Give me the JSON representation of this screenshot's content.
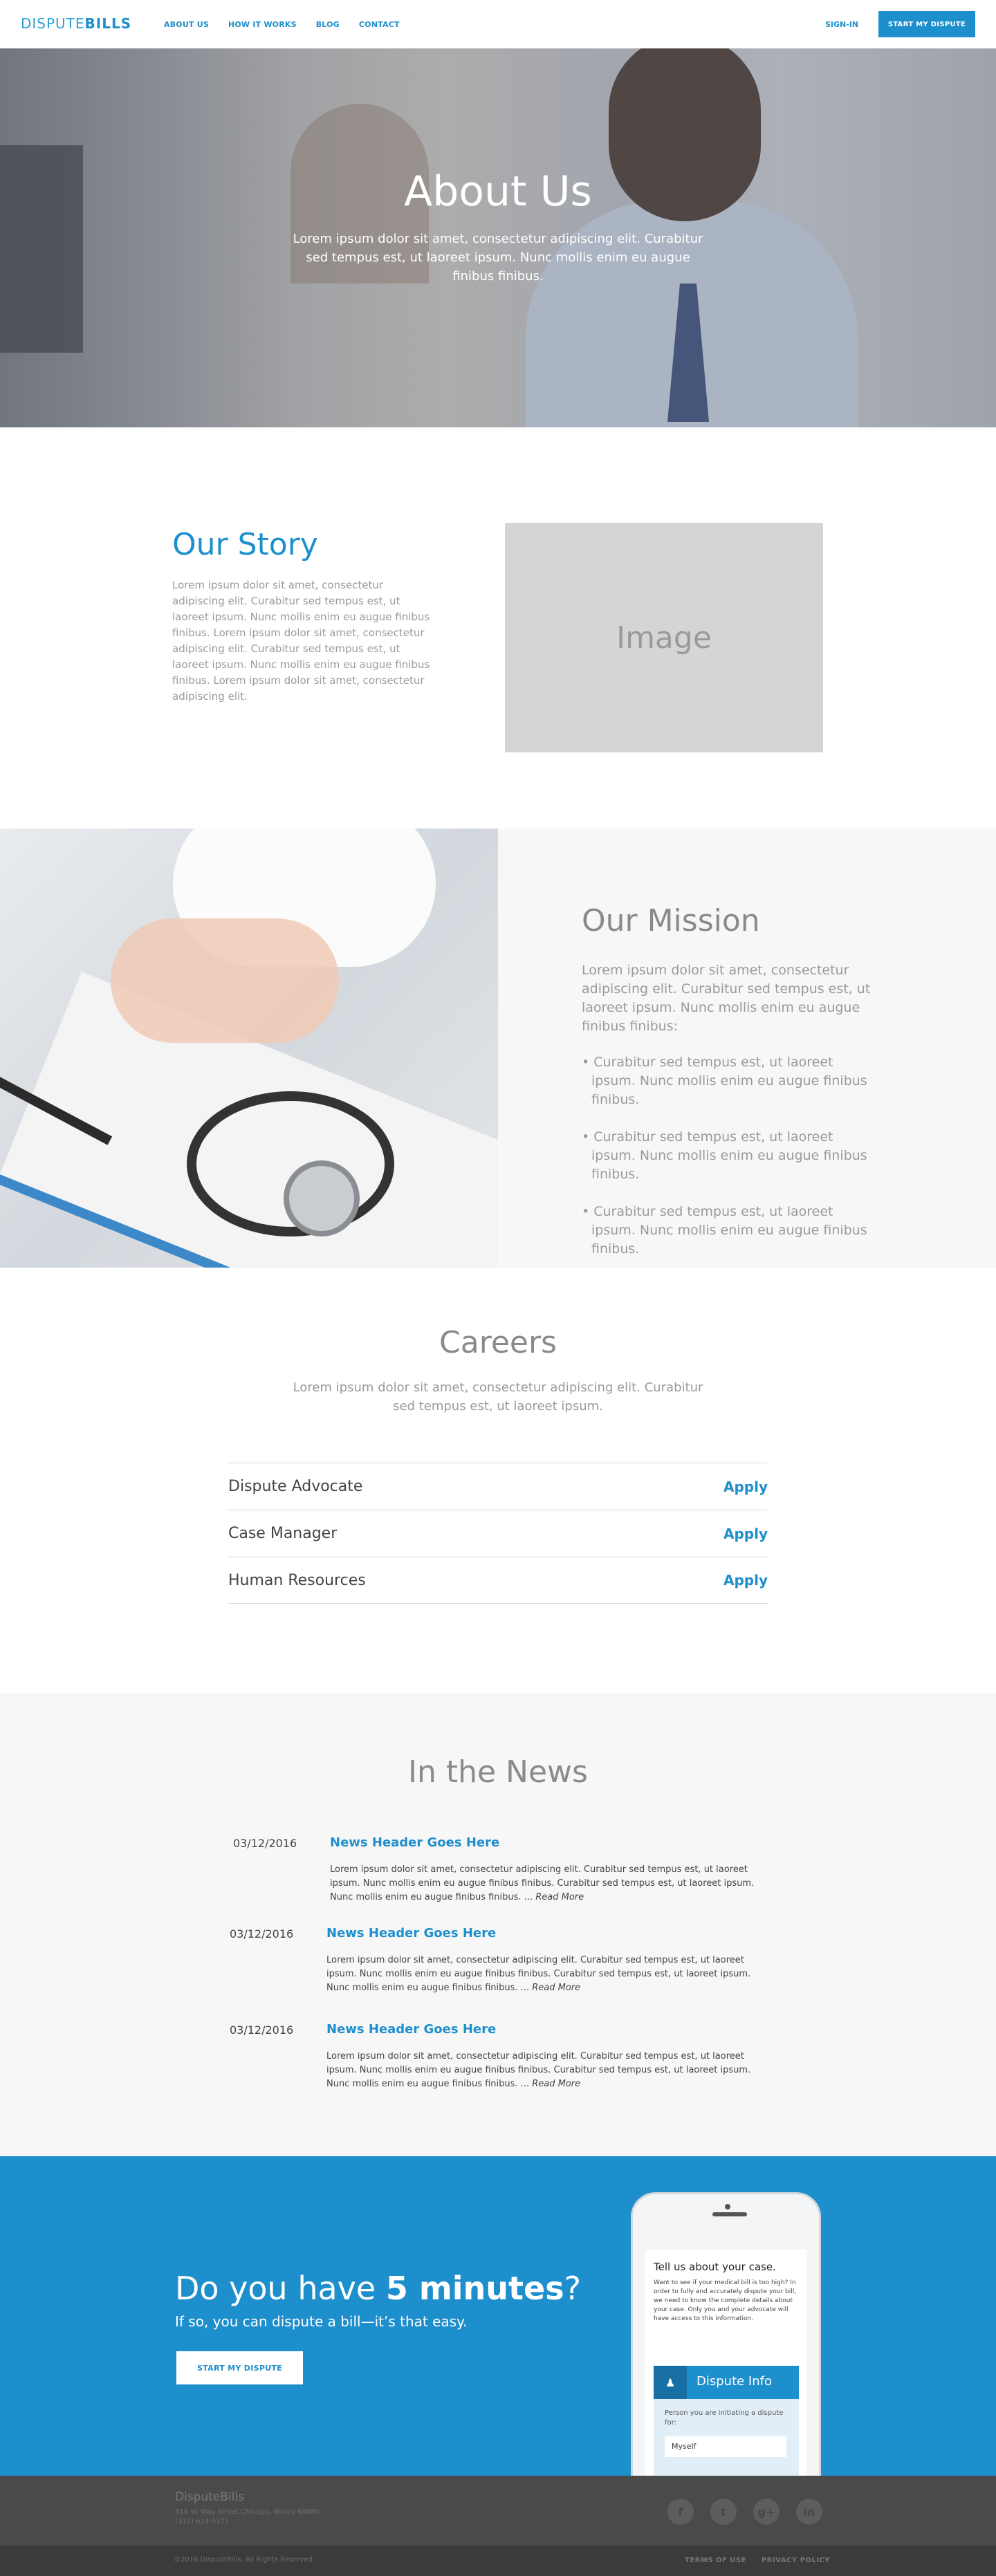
{
  "nav": {
    "logo_light": "DISPUTE",
    "logo_bold": "BILLS",
    "links": [
      "ABOUT US",
      "HOW IT WORKS",
      "BLOG",
      "CONTACT"
    ],
    "signin": "SIGN-IN",
    "cta": "START MY DISPUTE"
  },
  "hero": {
    "title": "About Us",
    "text": "Lorem ipsum dolor sit amet, consectetur adipiscing elit. Curabitur sed tempus est, ut laoreet ipsum. Nunc mollis enim eu augue finibus finibus."
  },
  "story": {
    "title": "Our Story",
    "text": "Lorem ipsum dolor sit amet, consectetur adipiscing elit. Curabitur sed tempus est, ut laoreet ipsum. Nunc mollis enim eu augue finibus finibus. Lorem ipsum dolor sit amet, consectetur adipiscing elit. Curabitur sed tempus est, ut laoreet ipsum. Nunc mollis enim eu augue finibus finibus. Lorem ipsum dolor sit amet, consectetur adipiscing elit.",
    "image_label": "Image"
  },
  "mission": {
    "title": "Our Mission",
    "text": "Lorem ipsum dolor sit amet, consectetur adipiscing elit. Curabitur sed tempus est, ut laoreet ipsum. Nunc mollis enim eu augue finibus finibus:",
    "bullets": [
      "• Curabitur sed tempus est, ut laoreet ipsum. Nunc mollis enim eu augue finibus finibus.",
      "• Curabitur sed tempus est, ut laoreet ipsum. Nunc mollis enim eu augue finibus finibus.",
      "• Curabitur sed tempus est, ut laoreet ipsum. Nunc mollis enim eu augue finibus finibus."
    ]
  },
  "careers": {
    "title": "Careers",
    "subtitle": "Lorem ipsum dolor sit amet, consectetur adipiscing elit. Curabitur sed tempus est, ut laoreet ipsum.",
    "positions": [
      {
        "name": "Dispute Advocate",
        "action": "Apply"
      },
      {
        "name": "Case Manager",
        "action": "Apply"
      },
      {
        "name": "Human Resources",
        "action": "Apply"
      }
    ]
  },
  "news": {
    "title": "In the News",
    "items": [
      {
        "date": "03/12/2016",
        "header": "News Header Goes Here",
        "body": "Lorem ipsum dolor sit amet, consectetur adipiscing elit. Curabitur sed tempus est, ut laoreet ipsum. Nunc mollis enim eu augue finibus finibus. Curabitur sed tempus est, ut laoreet ipsum. Nunc mollis enim eu augue finibus finibus.  ...",
        "more": "Read More"
      },
      {
        "date": "03/12/2016",
        "header": "News Header Goes Here",
        "body": "Lorem ipsum dolor sit amet, consectetur adipiscing elit. Curabitur sed tempus est, ut laoreet ipsum. Nunc mollis enim eu augue finibus finibus. Curabitur sed tempus est, ut laoreet ipsum. Nunc mollis enim eu augue finibus finibus.  ...",
        "more": "Read More"
      },
      {
        "date": "03/12/2016",
        "header": "News Header Goes Here",
        "body": "Lorem ipsum dolor sit amet, consectetur adipiscing elit. Curabitur sed tempus est, ut laoreet ipsum. Nunc mollis enim eu augue finibus finibus. Curabitur sed tempus est, ut laoreet ipsum. Nunc mollis enim eu augue finibus finibus.  ...",
        "more": "Read More"
      }
    ]
  },
  "cta": {
    "heading_pre": "Do you have ",
    "heading_bold": "5 minutes",
    "heading_post": "?",
    "subtext": "If so, you can dispute a bill—it’s that easy.",
    "button": "START MY DISPUTE",
    "phone": {
      "title": "Tell us about your case.",
      "text": "Want to see if your medical bill is too high? In order to fully and accurately dispute your bill, we need to know the complete details about your case. Only you and your advocate will have access to this information.",
      "bar_icon": "person-icon",
      "bar_label": "Dispute Info",
      "question": "Person you are initiating a dispute for:",
      "field_value": "Myself"
    }
  },
  "footer": {
    "brand": "DisputeBills",
    "address_line1": "616 W. Way Street Chicago, Illinois 60680",
    "address_line2": "(312) 624-9171",
    "social": [
      "f",
      "t",
      "g+",
      "in"
    ],
    "copyright": "©2016 DisputeBills. All Rights Reserved.",
    "links": [
      "TERMS OF USE",
      "PRIVACY POLICY"
    ]
  },
  "colors": {
    "accent": "#1e8fcd",
    "footer": "#4a4a4a"
  }
}
